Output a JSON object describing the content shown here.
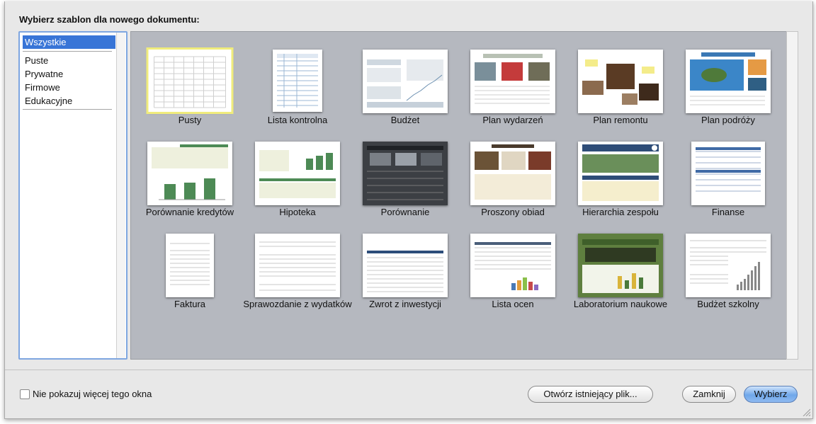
{
  "dialog": {
    "prompt": "Wybierz szablon dla nowego dokumentu:"
  },
  "sidebar": {
    "items": [
      {
        "label": "Wszystkie",
        "selected": true
      },
      {
        "label": "Puste"
      },
      {
        "label": "Prywatne"
      },
      {
        "label": "Firmowe"
      },
      {
        "label": "Edukacyjne"
      }
    ]
  },
  "templates": [
    {
      "label": "Pusty",
      "selected": true
    },
    {
      "label": "Lista kontrolna"
    },
    {
      "label": "Budżet"
    },
    {
      "label": "Plan wydarzeń"
    },
    {
      "label": "Plan remontu"
    },
    {
      "label": "Plan podróży"
    },
    {
      "label": "Porównanie kredytów"
    },
    {
      "label": "Hipoteka"
    },
    {
      "label": "Porównanie"
    },
    {
      "label": "Proszony obiad"
    },
    {
      "label": "Hierarchia zespołu"
    },
    {
      "label": "Finanse"
    },
    {
      "label": "Faktura"
    },
    {
      "label": "Sprawozdanie z wydatków"
    },
    {
      "label": "Zwrot z inwestycji"
    },
    {
      "label": "Lista ocen"
    },
    {
      "label": "Laboratorium naukowe"
    },
    {
      "label": "Budżet szkolny"
    }
  ],
  "footer": {
    "checkbox_label": "Nie pokazuj więcej tego okna",
    "open_existing": "Otwórz istniejący plik...",
    "close": "Zamknij",
    "choose": "Wybierz"
  },
  "colors": {
    "selection": "#3875d7",
    "gallery_bg": "#b5b8bf",
    "primary_button": "#6fa7ea"
  }
}
